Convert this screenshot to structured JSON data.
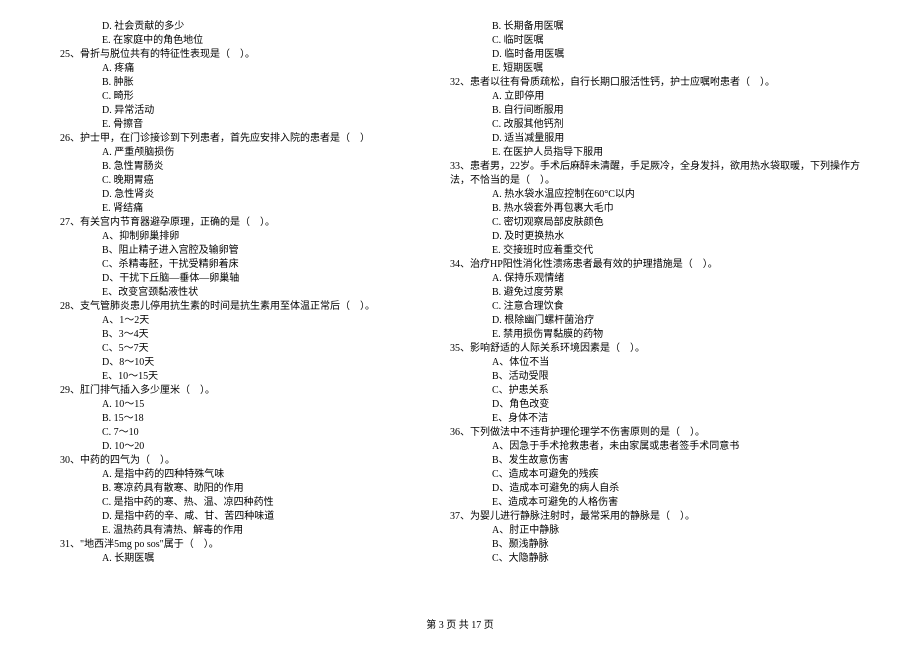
{
  "left": {
    "preD": "D. 社会贡献的多少",
    "preE": "E. 在家庭中的角色地位",
    "q25": "25、骨折与脱位共有的特征性表现是（    ）。",
    "q25A": "A. 疼痛",
    "q25B": "B. 肿胀",
    "q25C": "C. 畸形",
    "q25D": "D. 异常活动",
    "q25E": "E. 骨擦音",
    "q26": "26、护士甲，在门诊接诊到下列患者，首先应安排入院的患者是（    ）",
    "q26A": "A. 严重颅脑损伤",
    "q26B": "B. 急性胃肠炎",
    "q26C": "C. 晚期胃癌",
    "q26D": "D. 急性肾炎",
    "q26E": "E. 肾结痛",
    "q27": "27、有关宫内节育器避孕原理，正确的是（    ）。",
    "q27A": "A、抑制卵巢排卵",
    "q27B": "B、阻止精子进入宫腔及输卵管",
    "q27C": "C、杀精毒胚，干扰受精卵着床",
    "q27D": "D、干扰下丘脑—垂体—卵巢轴",
    "q27E": "E、改变宫颈黏液性状",
    "q28": "28、支气管肺炎患儿停用抗生素的时间是抗生素用至体温正常后（    ）。",
    "q28A": "A、1～2天",
    "q28B": "B、3～4天",
    "q28C": "C、5～7天",
    "q28D": "D、8～10天",
    "q28E": "E、10～15天",
    "q29": "29、肛门排气插入多少厘米（    ）。",
    "q29A": "A. 10～15",
    "q29B": "B. 15～18",
    "q29C": "C. 7～10",
    "q29D": "D. 10～20",
    "q30": "30、中药的四气为（    ）。",
    "q30A": "A. 是指中药的四种特殊气味",
    "q30B": "B. 寒凉药具有散寒、助阳的作用",
    "q30C": "C. 是指中药的寒、热、温、凉四种药性",
    "q30D": "D. 是指中药的辛、咸、甘、苦四种味道",
    "q30E": "E. 温热药具有清热、解毒的作用",
    "q31": "31、\"地西泮5mg po sos\"属于（    ）。",
    "q31A": "A. 长期医嘱"
  },
  "right": {
    "preB": "B. 长期备用医嘱",
    "preC": "C. 临时医嘱",
    "preD": "D. 临时备用医嘱",
    "preE": "E. 短期医嘱",
    "q32": "32、患者以往有骨质疏松，自行长期口服活性钙，护士应嘱咐患者（    ）。",
    "q32A": "A. 立即停用",
    "q32B": "B. 自行间断服用",
    "q32C": "C. 改服其他钙剂",
    "q32D": "D. 适当减量服用",
    "q32E": "E. 在医护人员指导下服用",
    "q33": "33、患者男，22岁。手术后麻醉未清醒，手足厥冷，全身发抖，欲用热水袋取暖，下列操作方",
    "q33b": "法，不恰当的是（    ）。",
    "q33A": "A. 热水袋水温应控制在60°C以内",
    "q33B": "B. 热水袋套外再包裹大毛巾",
    "q33C": "C. 密切观察局部皮肤颜色",
    "q33D": "D. 及时更换热水",
    "q33E": "E. 交接班时应着重交代",
    "q34": "34、治疗HP阳性消化性溃疡患者最有效的护理措施是（    ）。",
    "q34A": "A. 保持乐观情绪",
    "q34B": "B. 避免过度劳累",
    "q34C": "C. 注意合理饮食",
    "q34D": "D. 根除幽门螺杆菌治疗",
    "q34E": "E. 禁用损伤胃黏膜的药物",
    "q35": "35、影响舒适的人际关系环境因素是（    ）。",
    "q35A": "A、体位不当",
    "q35B": "B、活动受限",
    "q35C": "C、护患关系",
    "q35D": "D、角色改变",
    "q35E": "E、身体不洁",
    "q36": "36、下列做法中不违背护理伦理学不伤害原则的是（    ）。",
    "q36A": "A、因急于手术抢救患者，未由家属或患者签手术同意书",
    "q36B": "B、发生故意伤害",
    "q36C": "C、造成本可避免的残疾",
    "q36D": "D、造成本可避免的病人自杀",
    "q36E": "E、造成本可避免的人格伤害",
    "q37": "37、为婴儿进行静脉注射时，最常采用的静脉是（    ）。",
    "q37A": "A、肘正中静脉",
    "q37B": "B、颞浅静脉",
    "q37C": "C、大隐静脉"
  },
  "footer": "第 3 页 共 17 页"
}
